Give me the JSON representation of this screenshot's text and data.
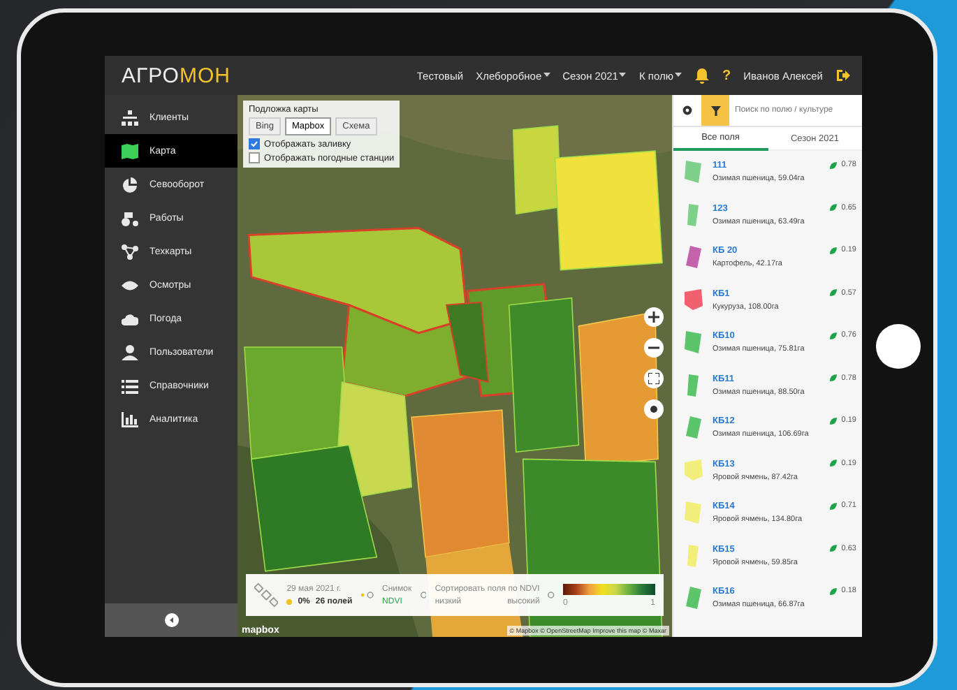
{
  "header": {
    "logo_left": "АГРО",
    "logo_right": "МОН",
    "menu": [
      {
        "label": "Тестовый",
        "dropdown": false
      },
      {
        "label": "Хлеборобное",
        "dropdown": true
      },
      {
        "label": "Сезон 2021",
        "dropdown": true
      },
      {
        "label": "К полю",
        "dropdown": true
      }
    ],
    "help": "?",
    "user": "Иванов Алексей"
  },
  "sidebar": {
    "items": [
      {
        "label": "Клиенты",
        "selected": false
      },
      {
        "label": "Карта",
        "selected": true
      },
      {
        "label": "Севооборот",
        "selected": false
      },
      {
        "label": "Работы",
        "selected": false
      },
      {
        "label": "Техкарты",
        "selected": false
      },
      {
        "label": "Осмотры",
        "selected": false
      },
      {
        "label": "Погода",
        "selected": false
      },
      {
        "label": "Пользователи",
        "selected": false
      },
      {
        "label": "Справочники",
        "selected": false
      },
      {
        "label": "Аналитика",
        "selected": false
      }
    ]
  },
  "layers": {
    "title": "Подложка карты",
    "bases": [
      {
        "label": "Bing",
        "selected": false
      },
      {
        "label": "Mapbox",
        "selected": true
      },
      {
        "label": "Схема",
        "selected": false
      }
    ],
    "options": [
      {
        "label": "Отображать заливку",
        "checked": true
      },
      {
        "label": "Отображать погодные станции",
        "checked": false
      }
    ]
  },
  "info": {
    "date": "29 мая 2021 г.",
    "cloud": "0%",
    "fields": "26 полей",
    "image_label": "Снимок",
    "image_value": "NDVI",
    "sort_label": "Сортировать поля по NDVI",
    "low": "низкий",
    "high": "высокий",
    "scale_min": "0",
    "scale_max": "1"
  },
  "map_logo": "mapbox",
  "attribution": "© Mapbox © OpenStreetMap Improve this map © Maxar",
  "panel": {
    "search": {
      "placeholder": "Поиск по полю / культуре"
    },
    "filter_on": true,
    "tabs": [
      {
        "label": "Все поля",
        "selected": true
      },
      {
        "label": "Сезон 2021",
        "selected": false
      }
    ],
    "fields": [
      {
        "name": "111",
        "crop": "Озимая пшеница, 59.04га",
        "ndvi": "0.78",
        "color": "#7fd08a"
      },
      {
        "name": "123",
        "crop": "Озимая пшеница, 63.49га",
        "ndvi": "0.65",
        "color": "#7fd08a"
      },
      {
        "name": "КБ 20",
        "crop": "Картофель, 42.17га",
        "ndvi": "0.19",
        "color": "#c462ac"
      },
      {
        "name": "КБ1",
        "crop": "Кукуруза, 108.00га",
        "ndvi": "0.57",
        "color": "#f0606e"
      },
      {
        "name": "КБ10",
        "crop": "Озимая пшеница, 75.81га",
        "ndvi": "0.76",
        "color": "#5cc46a"
      },
      {
        "name": "КБ11",
        "crop": "Озимая пшеница, 88.50га",
        "ndvi": "0.78",
        "color": "#5cc46a"
      },
      {
        "name": "КБ12",
        "crop": "Озимая пшеница, 106.69га",
        "ndvi": "0.19",
        "color": "#5cc46a"
      },
      {
        "name": "КБ13",
        "crop": "Яровой ячмень, 87.42га",
        "ndvi": "0.19",
        "color": "#f2ee7a"
      },
      {
        "name": "КБ14",
        "crop": "Яровой ячмень, 134.80га",
        "ndvi": "0.71",
        "color": "#f2ee7a"
      },
      {
        "name": "КБ15",
        "crop": "Яровой ячмень, 59.85га",
        "ndvi": "0.63",
        "color": "#f2ee7a"
      },
      {
        "name": "КБ16",
        "crop": "Озимая пшеница, 66.87га",
        "ndvi": "0.18",
        "color": "#5cc46a"
      }
    ]
  }
}
